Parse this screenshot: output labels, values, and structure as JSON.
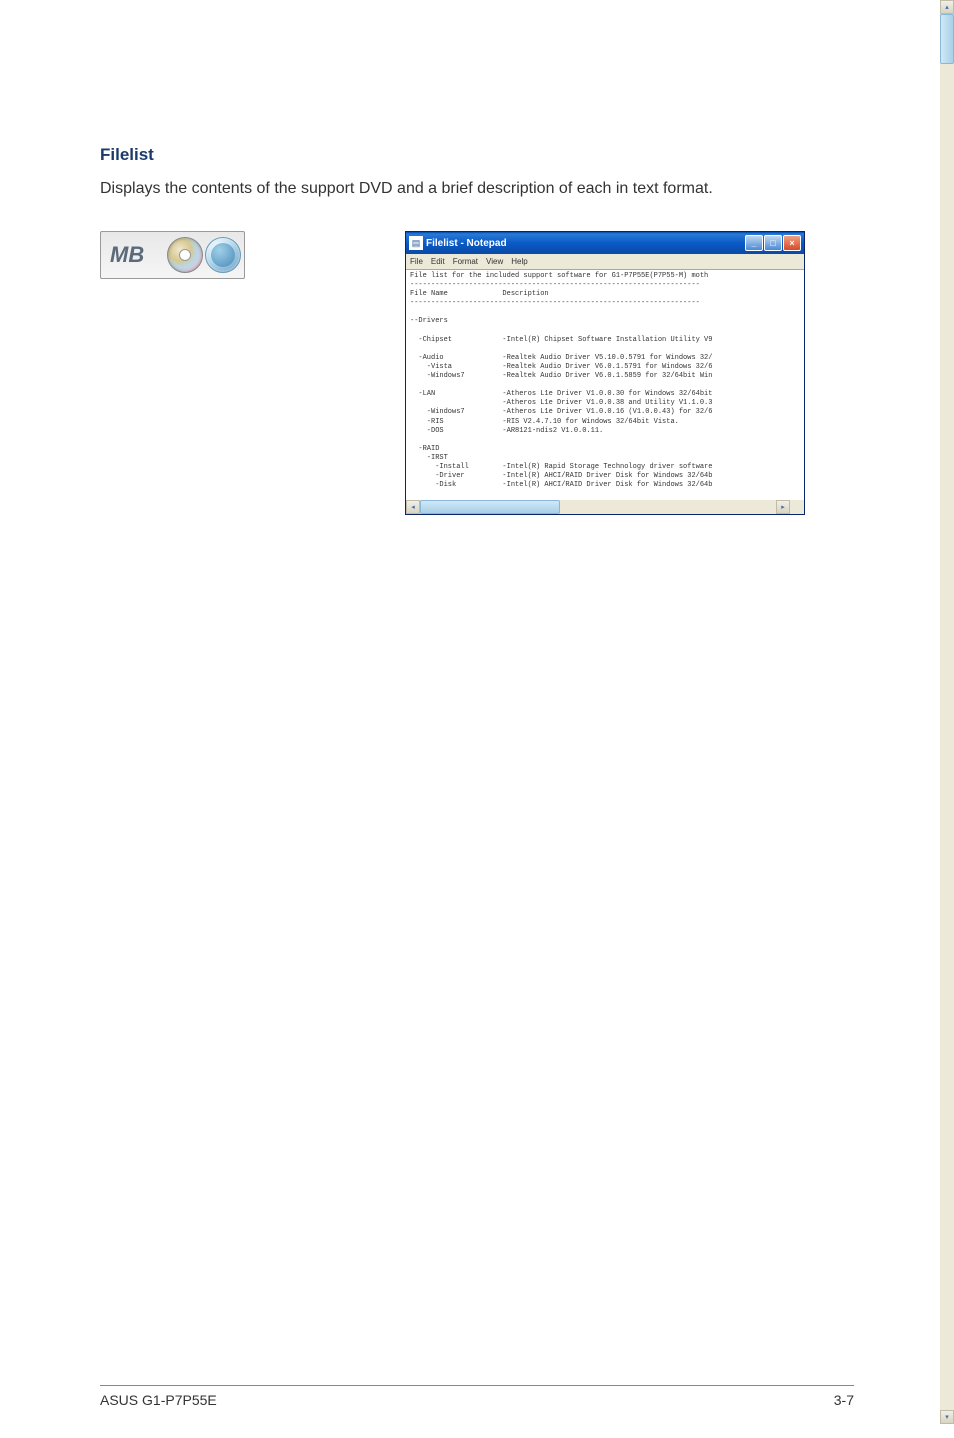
{
  "section": {
    "title": "Filelist",
    "desc": "Displays the contents of the support DVD and a brief description of each in text format."
  },
  "dvd_box": {
    "label": "MB"
  },
  "notepad": {
    "title": "Filelist - Notepad",
    "menu": [
      "File",
      "Edit",
      "Format",
      "View",
      "Help"
    ],
    "header_line": "File list for the included support software for G1-P7P55E(P7P55-M) moth",
    "col1": "File Name",
    "col2": "Description",
    "tree": "--Drivers\n\n  -Chipset            -Intel(R) Chipset Software Installation Utility V9\n\n  -Audio              -Realtek Audio Driver V5.10.0.5791 for Windows 32/\n    -Vista            -Realtek Audio Driver V6.0.1.5791 for Windows 32/6\n    -Windows7         -Realtek Audio Driver V6.0.1.5859 for 32/64bit Win\n\n  -LAN                -Atheros L1e Driver V1.0.0.30 for Windows 32/64bit\n                      -Atheros L1e Driver V1.0.0.38 and Utility V1.1.0.3\n    -Windows7         -Atheros L1e Driver V1.0.0.16 (V1.0.0.43) for 32/6\n    -RIS              -RIS V2.4.7.10 for Windows 32/64bit Vista.\n    -DOS              -AR8121-ndis2 V1.0.0.11.\n\n  -RAID\n    -IRST\n      -Install        -Intel(R) Rapid Storage Technology driver software\n      -Driver         -Intel(R) AHCI/RAID Driver Disk for Windows 32/64b\n      -Disk           -Intel(R) AHCI/RAID Driver Disk for Windows 32/64b"
  },
  "footer": {
    "left": "ASUS G1-P7P55E",
    "right": "3-7"
  }
}
